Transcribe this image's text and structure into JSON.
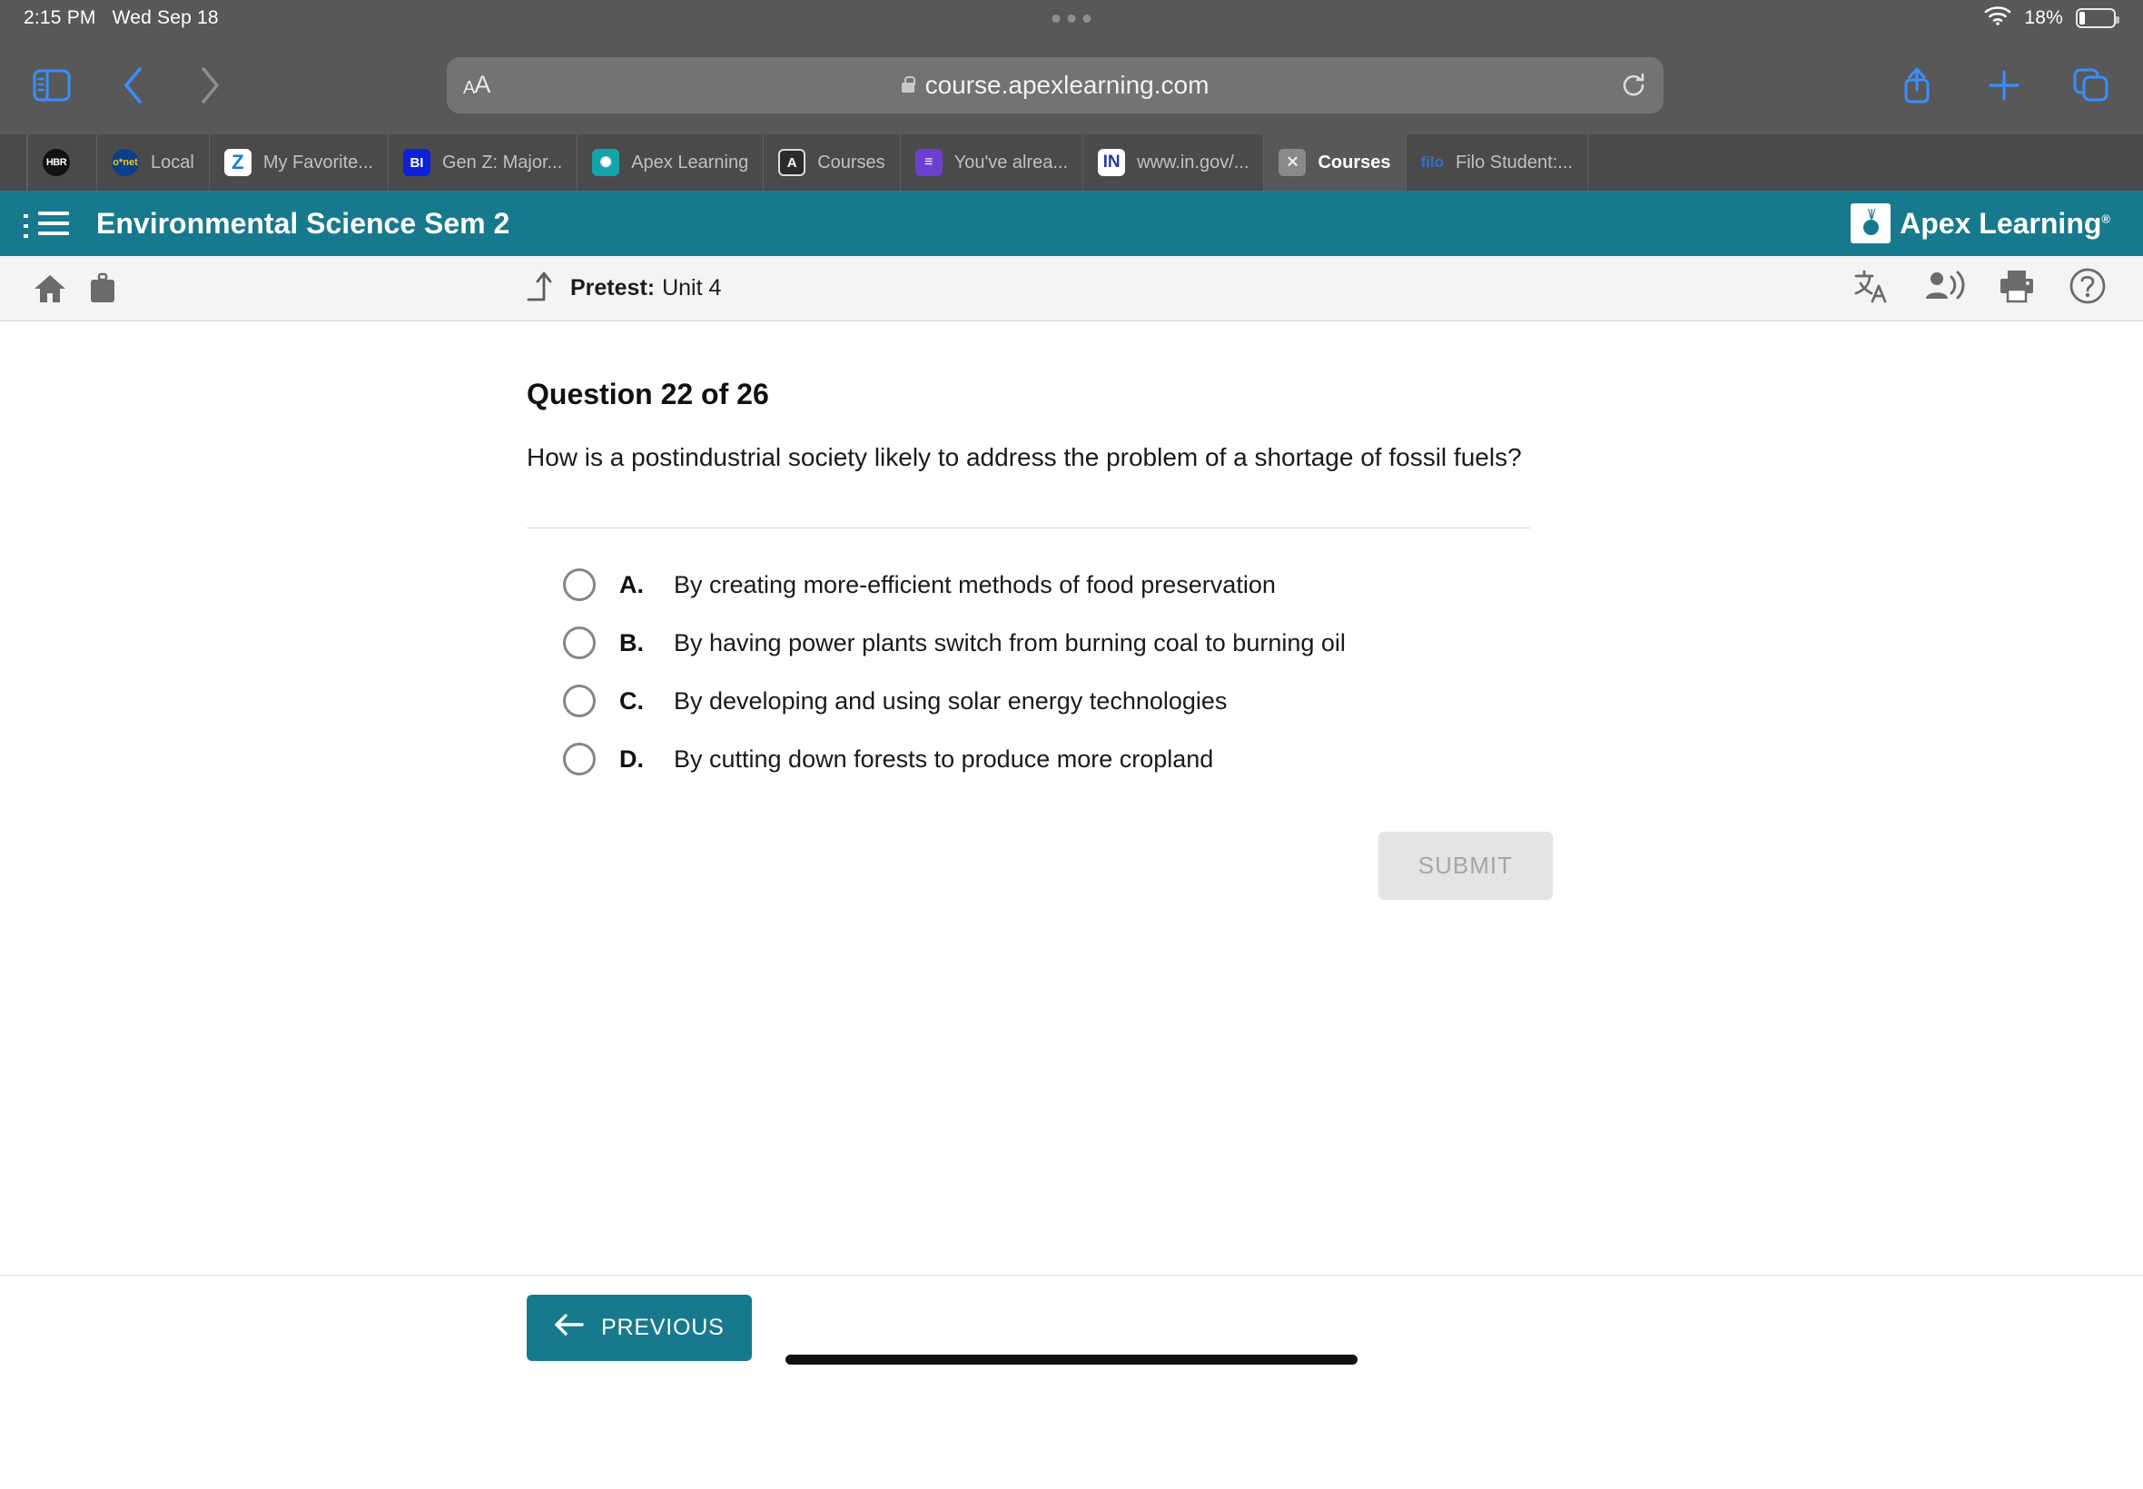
{
  "status_bar": {
    "time": "2:15 PM",
    "date": "Wed Sep 18",
    "battery_percent": "18%",
    "wifi_icon": "wifi-icon",
    "battery_icon": "battery-icon"
  },
  "browser": {
    "sidebar_icon": "sidebar-icon",
    "back_icon": "back-chevron-icon",
    "forward_icon": "forward-chevron-icon",
    "text_size_label": "AA",
    "lock_icon": "lock-icon",
    "url": "course.apexlearning.com",
    "reload_icon": "reload-icon",
    "share_icon": "share-icon",
    "new_tab_icon": "plus-icon",
    "tabs_overview_icon": "tabs-overview-icon"
  },
  "tabs": [
    {
      "label": "",
      "favicon": "hbr-icon",
      "favicon_text": "HBR",
      "active": false
    },
    {
      "label": "Local",
      "favicon": "onet-icon",
      "favicon_text": "o*net",
      "active": false
    },
    {
      "label": "My Favorite...",
      "favicon": "zillow-icon",
      "favicon_text": "Z",
      "active": false
    },
    {
      "label": "Gen Z: Major...",
      "favicon": "business-insider-icon",
      "favicon_text": "BI",
      "active": false
    },
    {
      "label": "Apex Learning",
      "favicon": "apex-learning-icon",
      "favicon_text": "✺",
      "active": false
    },
    {
      "label": "Courses",
      "favicon": "apex-a-icon",
      "favicon_text": "A",
      "active": false
    },
    {
      "label": "You've alrea...",
      "favicon": "google-forms-icon",
      "favicon_text": "≡",
      "active": false
    },
    {
      "label": "www.in.gov/...",
      "favicon": "indiana-gov-icon",
      "favicon_text": "IN",
      "active": false
    },
    {
      "label": "Courses",
      "favicon": "close-icon",
      "favicon_text": "✕",
      "active": true
    },
    {
      "label": "Filo Student:...",
      "favicon": "filo-icon",
      "favicon_text": "filo",
      "active": false
    }
  ],
  "course_header": {
    "menu_icon": "list-menu-icon",
    "title": "Environmental Science Sem 2",
    "logo_text": "Apex Learning",
    "logo_registered": "®",
    "logo_icon": "apex-lightbulb-icon",
    "background_color": "#17798e"
  },
  "sub_toolbar": {
    "home_icon": "home-icon",
    "briefcase_icon": "briefcase-icon",
    "exit_icon": "exit-arrow-icon",
    "activity_label": "Pretest:",
    "activity_name": "Unit 4",
    "translate_icon": "translate-icon",
    "read_aloud_icon": "read-aloud-icon",
    "print_icon": "print-icon",
    "help_icon": "help-icon"
  },
  "question": {
    "heading": "Question 22 of 26",
    "text": "How is a postindustrial society likely to address the problem of a shortage of fossil fuels?",
    "options": [
      {
        "letter": "A.",
        "text": "By creating more-efficient methods of food preservation",
        "selected": false
      },
      {
        "letter": "B.",
        "text": "By having power plants switch from burning coal to burning oil",
        "selected": false
      },
      {
        "letter": "C.",
        "text": "By developing and using solar energy technologies",
        "selected": false
      },
      {
        "letter": "D.",
        "text": "By cutting down forests to produce more cropland",
        "selected": false
      }
    ],
    "submit_label": "SUBMIT",
    "submit_enabled": false
  },
  "bottom_bar": {
    "previous_label": "PREVIOUS",
    "previous_arrow_icon": "arrow-left-icon"
  }
}
